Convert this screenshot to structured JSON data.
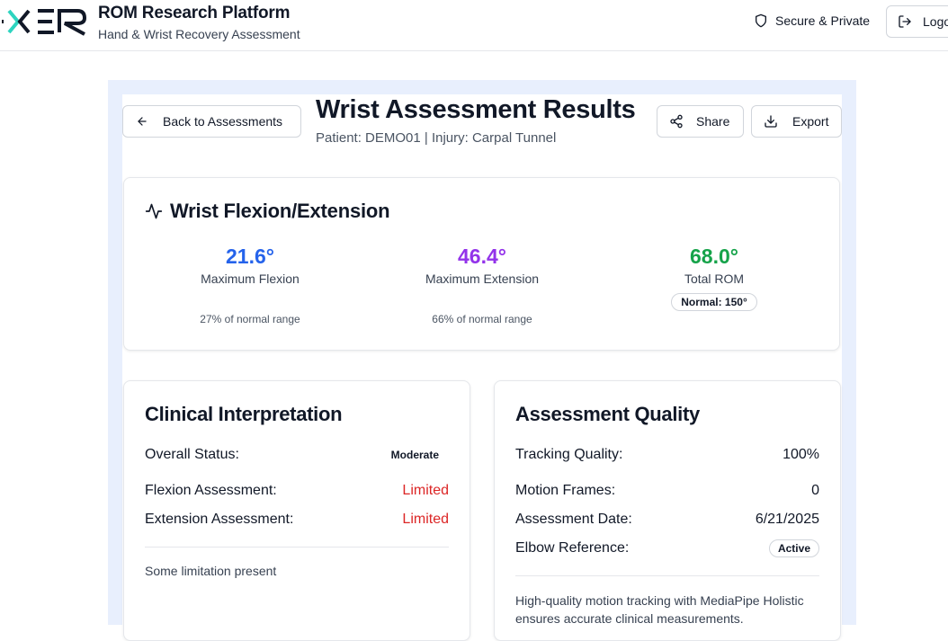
{
  "header": {
    "app_title": "ROM Research Platform",
    "app_subtitle": "Hand & Wrist Recovery Assessment",
    "secure_label": "Secure & Private",
    "logout_label": "Logout"
  },
  "page": {
    "back_label": "Back to Assessments",
    "title": "Wrist Assessment Results",
    "subtitle": "Patient: DEMO01 | Injury: Carpal Tunnel",
    "share_label": "Share",
    "export_label": "Export"
  },
  "rom": {
    "title": "Wrist Flexion/Extension",
    "flexion": {
      "value": "21.6°",
      "label": "Maximum Flexion",
      "note": "27% of normal range",
      "color": "#2563eb"
    },
    "extension": {
      "value": "46.4°",
      "label": "Maximum Extension",
      "note": "66% of normal range",
      "color": "#9333ea"
    },
    "total": {
      "value": "68.0°",
      "label": "Total ROM",
      "badge": "Normal: 150°",
      "color": "#16a34a"
    }
  },
  "clinical": {
    "title": "Clinical Interpretation",
    "overall_label": "Overall Status:",
    "overall_value": "Moderate",
    "flexion_label": "Flexion Assessment:",
    "flexion_value": "Limited",
    "extension_label": "Extension Assessment:",
    "extension_value": "Limited",
    "note": "Some limitation present"
  },
  "quality": {
    "title": "Assessment Quality",
    "tracking_label": "Tracking Quality:",
    "tracking_value": "100%",
    "frames_label": "Motion Frames:",
    "frames_value": "0",
    "date_label": "Assessment Date:",
    "date_value": "6/21/2025",
    "elbow_label": "Elbow Reference:",
    "elbow_value": "Active",
    "description": "High-quality motion tracking with MediaPipe Holistic ensures accurate clinical measurements."
  },
  "icons": {
    "secure": "shield-icon",
    "logout": "logout-icon",
    "back": "arrow-left-icon",
    "share": "share-icon",
    "export": "download-icon",
    "rom": "activity-icon"
  }
}
